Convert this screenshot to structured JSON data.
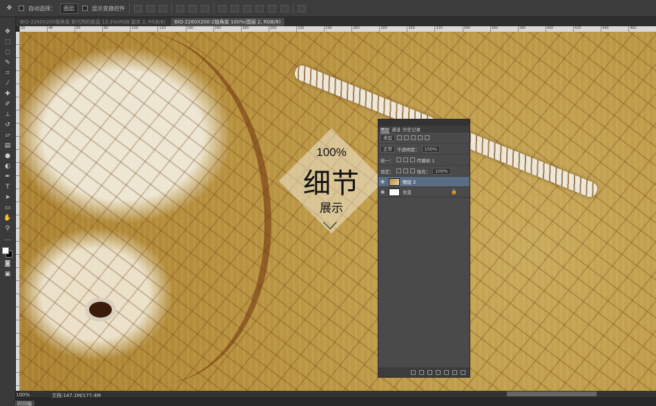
{
  "optionbar": {
    "auto_select_label": "自动选择：",
    "auto_select_value": "图层",
    "show_transform_label": "显示变换控件"
  },
  "tabs": [
    {
      "label": "BIQ-2260X200独角兽 新代购的新品 13.3%(RGB 副本 2, RGB/8)",
      "active": false
    },
    {
      "label": "BIQ-2260X200-2独角兽 100%(图层 2, RGB/8)",
      "active": true
    }
  ],
  "ruler_ticks": [
    "20",
    "40",
    "60",
    "80",
    "100",
    "120",
    "140",
    "160",
    "180",
    "200",
    "220",
    "240",
    "260",
    "280",
    "300",
    "320",
    "340",
    "360",
    "380",
    "400",
    "420",
    "440",
    "460"
  ],
  "overlay": {
    "percent": "100%",
    "title": "细节",
    "subtitle": "展示"
  },
  "layers_panel": {
    "tabs": [
      "图层",
      "通道",
      "历史记录"
    ],
    "kind_label": "类型",
    "blend_mode": "正常",
    "opacity_label": "不透明度：",
    "opacity_value": "100%",
    "unify_label": "统一：",
    "propagate_label": "传播帧 1",
    "lock_label": "锁定：",
    "fill_label": "填充：",
    "fill_value": "100%",
    "layers": [
      {
        "name": "图层 2",
        "thumb": "image",
        "selected": true
      },
      {
        "name": "背景",
        "thumb": "white",
        "selected": false
      }
    ]
  },
  "status": {
    "zoom": "100%",
    "doc": "文档:147.1M/177.4M",
    "timeline": "时间轴"
  }
}
